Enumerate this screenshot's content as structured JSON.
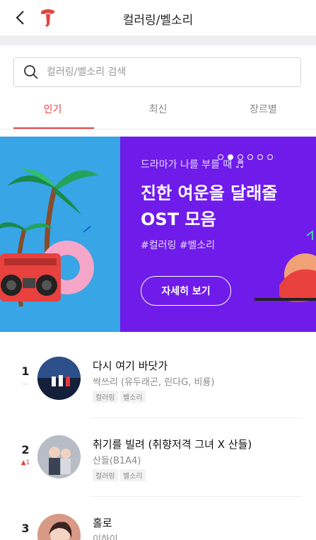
{
  "header": {
    "title": "컬러링/벨소리",
    "back_icon": "chevron-left-icon",
    "logo": "t-brand-logo"
  },
  "search": {
    "placeholder": "컬러링/벨소리 검색",
    "icon": "search-icon"
  },
  "tabs": [
    {
      "label": "인기",
      "active": true
    },
    {
      "label": "최신",
      "active": false
    },
    {
      "label": "장르별",
      "active": false
    }
  ],
  "banner": {
    "subtitle": "드라마가 나를 부를 때 ♬",
    "headline1": "진한 여운을 달래줄",
    "headline2": "OST 모음",
    "tags": "#컬러링 #벨소리",
    "button": "자세히 보기",
    "dots_total": 6,
    "dots_active": 1,
    "colors": {
      "left_bg": "#37a5e6",
      "right_bg": "#6f1bea"
    }
  },
  "chart": [
    {
      "rank": "1",
      "change": "—",
      "change_type": "same",
      "title": "다시 여기 바닷가",
      "artist": "싹쓰리 (유두래곤, 린다G, 비룡)",
      "tags": [
        "컬러링",
        "벨소리"
      ]
    },
    {
      "rank": "2",
      "change": "▲1",
      "change_type": "up",
      "title": "취기를 빌려 (취향저격 그녀 X 산들)",
      "artist": "산들(B1A4)",
      "tags": [
        "컬러링",
        "벨소리"
      ]
    },
    {
      "rank": "3",
      "change": "",
      "change_type": "",
      "title": "홀로",
      "artist": "이하이",
      "tags": []
    }
  ],
  "colors": {
    "accent": "#e8413e",
    "text": "#222222",
    "muted": "#8a8a8a"
  }
}
